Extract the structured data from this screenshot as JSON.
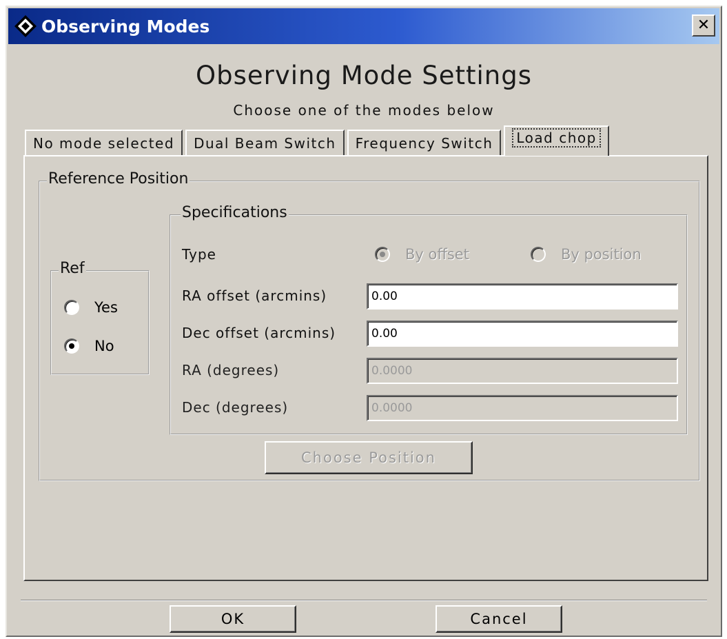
{
  "window": {
    "title": "Observing Modes",
    "close_glyph": "✕"
  },
  "header": {
    "title": "Observing Mode Settings",
    "subtitle": "Choose one of the modes below"
  },
  "tabs": [
    {
      "label": "No mode selected"
    },
    {
      "label": "Dual Beam Switch"
    },
    {
      "label": "Frequency Switch"
    },
    {
      "label": "Load chop",
      "active": true
    }
  ],
  "reference_position": {
    "label": "Reference Position",
    "ref": {
      "label": "Ref",
      "options": [
        {
          "label": "Yes",
          "selected": false
        },
        {
          "label": "No",
          "selected": true
        }
      ]
    },
    "specifications": {
      "label": "Specifications",
      "type_label": "Type",
      "type_options": [
        {
          "label": "By offset",
          "selected": true,
          "enabled": false
        },
        {
          "label": "By position",
          "selected": false,
          "enabled": false
        }
      ],
      "fields": [
        {
          "label": "RA offset (arcmins)",
          "value": "0.00",
          "enabled": true
        },
        {
          "label": "Dec offset (arcmins)",
          "value": "0.00",
          "enabled": true
        },
        {
          "label": "RA (degrees)",
          "value": "0.0000",
          "enabled": false
        },
        {
          "label": "Dec (degrees)",
          "value": "0.0000",
          "enabled": false
        }
      ]
    },
    "choose_position_label": "Choose Position"
  },
  "footer": {
    "ok_label": "OK",
    "cancel_label": "Cancel"
  },
  "colors": {
    "titlebar_start": "#0a2a88",
    "titlebar_end": "#a6c8f0",
    "window_bg": "#d4d0c8"
  }
}
